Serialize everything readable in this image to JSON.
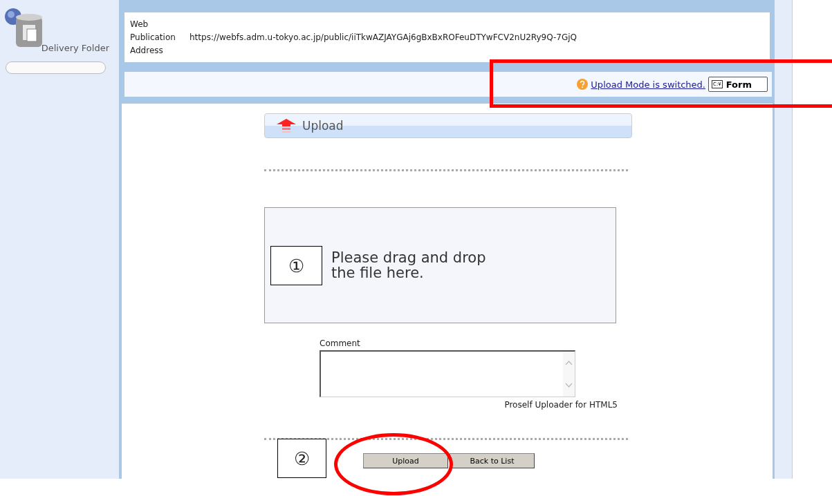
{
  "sidebar": {
    "title": "Delivery Folder"
  },
  "publication": {
    "label": "Web Publication Address",
    "url": "https://webfs.adm.u-tokyo.ac.jp/public/iiTkwAZJAYGAj6gBxBxROFeuDTYwFCV2nU2Ry9Q-7GjQ"
  },
  "mode_bar": {
    "link": "Upload Mode is switched.",
    "button_icon_text": "C:¥",
    "button": "Form"
  },
  "panel_title": "Upload",
  "drop_zone": {
    "text": "Please drag and drop the file here."
  },
  "comment": {
    "label": "Comment"
  },
  "uploader_note": "Proself Uploader for HTML5",
  "buttons": [
    "Upload",
    "Back to List"
  ],
  "annotations": [
    {
      "kind": "callout",
      "text": "①"
    },
    {
      "kind": "callout",
      "text": "②"
    },
    {
      "kind": "rectangle"
    },
    {
      "kind": "ellipse"
    }
  ]
}
